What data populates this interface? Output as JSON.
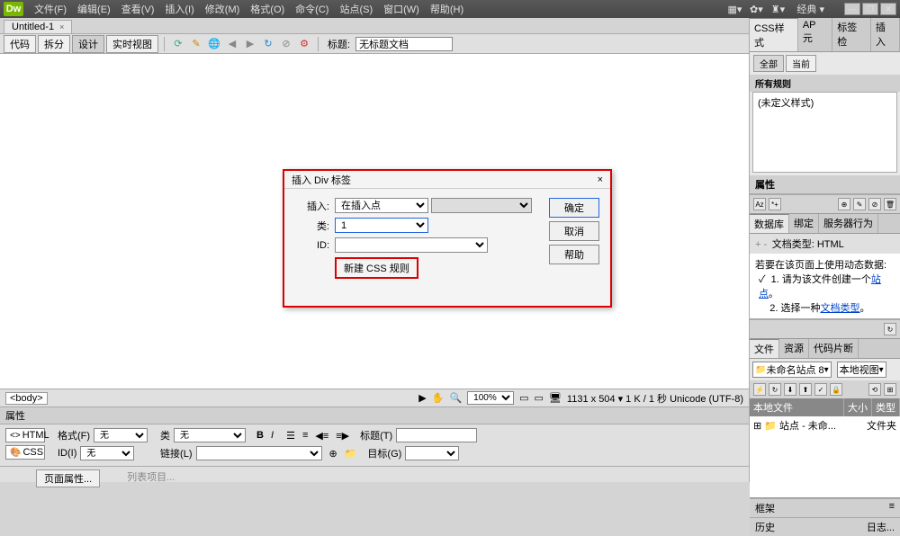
{
  "menubar": {
    "items": [
      "文件(F)",
      "编辑(E)",
      "查看(V)",
      "插入(I)",
      "修改(M)",
      "格式(O)",
      "命令(C)",
      "站点(S)",
      "窗口(W)",
      "帮助(H)"
    ],
    "layout_label": "经典"
  },
  "doctab": {
    "name": "Untitled-1",
    "close": "×"
  },
  "toolbar": {
    "view_code": "代码",
    "view_split": "拆分",
    "view_design": "设计",
    "view_live": "实时视图",
    "title_label": "标题:",
    "title_value": "无标题文档"
  },
  "dialog": {
    "title": "插入 Div 标签",
    "close": "×",
    "insert_label": "插入:",
    "insert_value": "在插入点",
    "class_label": "类:",
    "class_value": "1",
    "id_label": "ID:",
    "id_value": "",
    "new_css": "新建 CSS 规则",
    "ok": "确定",
    "cancel": "取消",
    "help": "帮助"
  },
  "statusbar": {
    "tag": "<body>",
    "zoom": "100%",
    "info": "1131 x 504 ▾  1 K / 1 秒 Unicode (UTF-8)"
  },
  "properties": {
    "header": "属性",
    "tab_html": "HTML",
    "tab_css": "CSS",
    "format_label": "格式(F)",
    "format_value": "无",
    "class_label": "类",
    "class_value": "无",
    "id_label": "ID(I)",
    "id_value": "无",
    "link_label": "链接(L)",
    "title_label": "标题(T)",
    "target_label": "目标(G)",
    "page_props": "页面属性...",
    "list_items": "列表项目..."
  },
  "css_panel": {
    "tabs": [
      "CSS样式",
      "AP 元",
      "标签检",
      "插入"
    ],
    "sub_all": "全部",
    "sub_current": "当前",
    "heading": "所有规则",
    "no_styles": "(未定义样式)"
  },
  "attr_panel": {
    "heading": "属性"
  },
  "db_panel": {
    "tabs": [
      "数据库",
      "绑定",
      "服务器行为"
    ],
    "doc_type": "文档类型: HTML",
    "intro": "若要在该页面上使用动态数据:",
    "step1_a": "请为该文件创建一个",
    "step1_link": "站点",
    "step1_b": "。",
    "step2_a": "选择一种",
    "step2_link": "文档类型",
    "step2_b": "。"
  },
  "files_panel": {
    "tabs": [
      "文件",
      "资源",
      "代码片断"
    ],
    "site_value": "未命名站点 8",
    "view_value": "本地视图",
    "col_file": "本地文件",
    "col_size": "大小",
    "col_type": "类型",
    "row_site": "站点 - 未命...",
    "row_type": "文件夹"
  },
  "bottom_panels": {
    "frames": "框架",
    "history": "历史",
    "log": "日志..."
  }
}
